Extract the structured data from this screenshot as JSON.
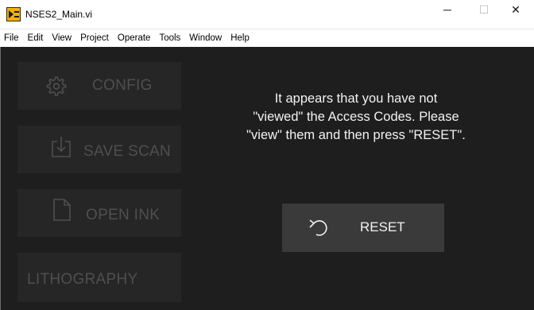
{
  "window": {
    "title": "NSES2_Main.vi",
    "minimize_glyph": "─",
    "maximize_glyph": "☐",
    "close_glyph": "✕",
    "icon": "labview-vi-icon"
  },
  "menu": [
    "File",
    "Edit",
    "View",
    "Project",
    "Operate",
    "Tools",
    "Window",
    "Help"
  ],
  "sidebar": {
    "config": {
      "label": "CONFIG",
      "icon": "gear-icon"
    },
    "save_scan": {
      "label": "SAVE SCAN",
      "icon": "save-icon"
    },
    "open_ink": {
      "label": "OPEN INK",
      "icon": "document-icon"
    },
    "lithography": {
      "label": "LITHOGRAPHY"
    }
  },
  "message": {
    "line1": "It appears that you have not",
    "line2": "\"viewed\" the Access Codes. Please",
    "line3": "\"view\" them and then press \"RESET\"."
  },
  "reset": {
    "label": "RESET",
    "icon": "undo-icon"
  },
  "colors": {
    "panel_bg": "#1e1e1e",
    "sidebar_button_bg": "#262626",
    "sidebar_text": "#4f4f4f",
    "reset_button_bg": "#3a3a3a",
    "message_text": "#f2f2f2"
  }
}
